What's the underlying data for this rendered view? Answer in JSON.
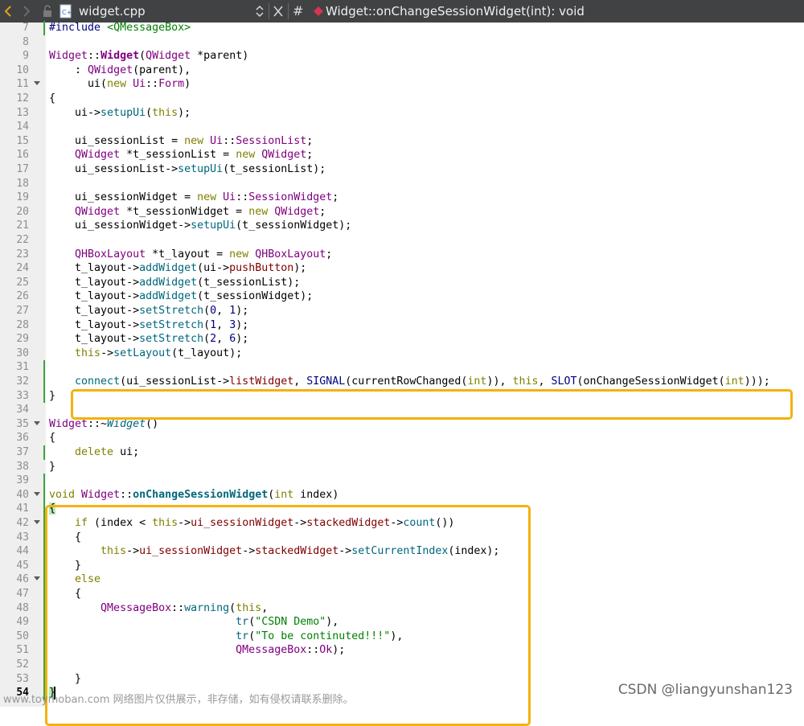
{
  "toolbar": {
    "file_name": "widget.cpp",
    "symbol": "Widget::onChangeSessionWidget(int): void",
    "hash": "#"
  },
  "watermarks": {
    "left": "www.toymoban.com 网络图片仅供展示，非存储，如有侵权请联系删除。",
    "right": "CSDN @liangyunshan123"
  },
  "colors": {
    "toolbar_bg": "#404244",
    "highlight_box": "#f5b10f",
    "change_marker": "#3da53d",
    "type": "#800080",
    "keyword": "#808000",
    "function": "#00677c",
    "string": "#008000"
  },
  "code_lines": [
    {
      "n": "7",
      "fold": false,
      "chg": true,
      "segs": [
        [
          "#include ",
          "pp"
        ],
        [
          "<QMessageBox>",
          "str"
        ]
      ]
    },
    {
      "n": "8",
      "fold": false,
      "chg": false,
      "segs": []
    },
    {
      "n": "9",
      "fold": false,
      "chg": false,
      "segs": [
        [
          "Widget",
          "type"
        ],
        [
          "::",
          ""
        ],
        [
          "Widget",
          "type bold"
        ],
        [
          "(",
          ""
        ],
        [
          "QWidget",
          "type"
        ],
        [
          " *parent)",
          ""
        ]
      ]
    },
    {
      "n": "10",
      "fold": false,
      "chg": false,
      "segs": [
        [
          "    : ",
          ""
        ],
        [
          "QWidget",
          "type"
        ],
        [
          "(parent),",
          ""
        ]
      ]
    },
    {
      "n": "11",
      "fold": true,
      "chg": false,
      "segs": [
        [
          "      ui(",
          ""
        ],
        [
          "new",
          "kw"
        ],
        [
          " ",
          ""
        ],
        [
          "Ui",
          "type"
        ],
        [
          "::",
          ""
        ],
        [
          "Form",
          "type"
        ],
        [
          ")",
          ""
        ]
      ]
    },
    {
      "n": "12",
      "fold": false,
      "chg": false,
      "segs": [
        [
          "{",
          ""
        ]
      ]
    },
    {
      "n": "13",
      "fold": false,
      "chg": false,
      "segs": [
        [
          "    ui->",
          ""
        ],
        [
          "setupUi",
          "fn"
        ],
        [
          "(",
          ""
        ],
        [
          "this",
          "kw"
        ],
        [
          ");",
          ""
        ]
      ]
    },
    {
      "n": "14",
      "fold": false,
      "chg": false,
      "segs": []
    },
    {
      "n": "15",
      "fold": false,
      "chg": false,
      "segs": [
        [
          "    ui_sessionList = ",
          ""
        ],
        [
          "new",
          "kw"
        ],
        [
          " ",
          ""
        ],
        [
          "Ui",
          "type"
        ],
        [
          "::",
          ""
        ],
        [
          "SessionList",
          "type"
        ],
        [
          ";",
          ""
        ]
      ]
    },
    {
      "n": "16",
      "fold": false,
      "chg": false,
      "segs": [
        [
          "    ",
          ""
        ],
        [
          "QWidget",
          "type"
        ],
        [
          " *t_sessionList = ",
          ""
        ],
        [
          "new",
          "kw"
        ],
        [
          " ",
          ""
        ],
        [
          "QWidget",
          "type"
        ],
        [
          ";",
          ""
        ]
      ]
    },
    {
      "n": "17",
      "fold": false,
      "chg": false,
      "segs": [
        [
          "    ui_sessionList->",
          ""
        ],
        [
          "setupUi",
          "fn"
        ],
        [
          "(t_sessionList);",
          ""
        ]
      ]
    },
    {
      "n": "18",
      "fold": false,
      "chg": false,
      "segs": []
    },
    {
      "n": "19",
      "fold": false,
      "chg": false,
      "segs": [
        [
          "    ui_sessionWidget = ",
          ""
        ],
        [
          "new",
          "kw"
        ],
        [
          " ",
          ""
        ],
        [
          "Ui",
          "type"
        ],
        [
          "::",
          ""
        ],
        [
          "SessionWidget",
          "type"
        ],
        [
          ";",
          ""
        ]
      ]
    },
    {
      "n": "20",
      "fold": false,
      "chg": false,
      "segs": [
        [
          "    ",
          ""
        ],
        [
          "QWidget",
          "type"
        ],
        [
          " *t_sessionWidget = ",
          ""
        ],
        [
          "new",
          "kw"
        ],
        [
          " ",
          ""
        ],
        [
          "QWidget",
          "type"
        ],
        [
          ";",
          ""
        ]
      ]
    },
    {
      "n": "21",
      "fold": false,
      "chg": false,
      "segs": [
        [
          "    ui_sessionWidget->",
          ""
        ],
        [
          "setupUi",
          "fn"
        ],
        [
          "(t_sessionWidget);",
          ""
        ]
      ]
    },
    {
      "n": "22",
      "fold": false,
      "chg": false,
      "segs": []
    },
    {
      "n": "23",
      "fold": false,
      "chg": false,
      "segs": [
        [
          "    ",
          ""
        ],
        [
          "QHBoxLayout",
          "type"
        ],
        [
          " *t_layout = ",
          ""
        ],
        [
          "new",
          "kw"
        ],
        [
          " ",
          ""
        ],
        [
          "QHBoxLayout",
          "type"
        ],
        [
          ";",
          ""
        ]
      ]
    },
    {
      "n": "24",
      "fold": false,
      "chg": false,
      "segs": [
        [
          "    t_layout->",
          ""
        ],
        [
          "addWidget",
          "fn"
        ],
        [
          "(ui->",
          ""
        ],
        [
          "pushButton",
          "mem"
        ],
        [
          ");",
          ""
        ]
      ]
    },
    {
      "n": "25",
      "fold": false,
      "chg": false,
      "segs": [
        [
          "    t_layout->",
          ""
        ],
        [
          "addWidget",
          "fn"
        ],
        [
          "(t_sessionList);",
          ""
        ]
      ]
    },
    {
      "n": "26",
      "fold": false,
      "chg": false,
      "segs": [
        [
          "    t_layout->",
          ""
        ],
        [
          "addWidget",
          "fn"
        ],
        [
          "(t_sessionWidget);",
          ""
        ]
      ]
    },
    {
      "n": "27",
      "fold": false,
      "chg": false,
      "segs": [
        [
          "    t_layout->",
          ""
        ],
        [
          "setStretch",
          "fn"
        ],
        [
          "(",
          ""
        ],
        [
          "0",
          "num"
        ],
        [
          ", ",
          ""
        ],
        [
          "1",
          "num"
        ],
        [
          ");",
          ""
        ]
      ]
    },
    {
      "n": "28",
      "fold": false,
      "chg": false,
      "segs": [
        [
          "    t_layout->",
          ""
        ],
        [
          "setStretch",
          "fn"
        ],
        [
          "(",
          ""
        ],
        [
          "1",
          "num"
        ],
        [
          ", ",
          ""
        ],
        [
          "3",
          "num"
        ],
        [
          ");",
          ""
        ]
      ]
    },
    {
      "n": "29",
      "fold": false,
      "chg": false,
      "segs": [
        [
          "    t_layout->",
          ""
        ],
        [
          "setStretch",
          "fn"
        ],
        [
          "(",
          ""
        ],
        [
          "2",
          "num"
        ],
        [
          ", ",
          ""
        ],
        [
          "6",
          "num"
        ],
        [
          ");",
          ""
        ]
      ]
    },
    {
      "n": "30",
      "fold": false,
      "chg": false,
      "segs": [
        [
          "    ",
          ""
        ],
        [
          "this",
          "kw"
        ],
        [
          "->",
          ""
        ],
        [
          "setLayout",
          "fn"
        ],
        [
          "(t_layout);",
          ""
        ]
      ]
    },
    {
      "n": "31",
      "fold": false,
      "chg": true,
      "segs": []
    },
    {
      "n": "32",
      "fold": false,
      "chg": true,
      "segs": [
        [
          "    ",
          ""
        ],
        [
          "connect",
          "fn"
        ],
        [
          "(ui_sessionList->",
          ""
        ],
        [
          "listWidget",
          "mem"
        ],
        [
          ", ",
          ""
        ],
        [
          "SIGNAL",
          "mac"
        ],
        [
          "(currentRowChanged(",
          ""
        ],
        [
          "int",
          "kw"
        ],
        [
          ")), ",
          ""
        ],
        [
          "this",
          "kw"
        ],
        [
          ", ",
          ""
        ],
        [
          "SLOT",
          "mac"
        ],
        [
          "(onChangeSessionWidget(",
          ""
        ],
        [
          "int",
          "kw"
        ],
        [
          ")));",
          ""
        ]
      ]
    },
    {
      "n": "33",
      "fold": false,
      "chg": true,
      "segs": [
        [
          "}",
          ""
        ]
      ]
    },
    {
      "n": "34",
      "fold": false,
      "chg": false,
      "segs": []
    },
    {
      "n": "35",
      "fold": true,
      "chg": false,
      "segs": [
        [
          "Widget",
          "type"
        ],
        [
          "::~",
          ""
        ],
        [
          "Widget",
          "fn ital"
        ],
        [
          "()",
          ""
        ]
      ]
    },
    {
      "n": "36",
      "fold": false,
      "chg": false,
      "segs": [
        [
          "{",
          ""
        ]
      ]
    },
    {
      "n": "37",
      "fold": false,
      "chg": true,
      "segs": [
        [
          "    ",
          ""
        ],
        [
          "delete",
          "kw"
        ],
        [
          " ui;",
          ""
        ]
      ]
    },
    {
      "n": "38",
      "fold": false,
      "chg": false,
      "segs": [
        [
          "}",
          ""
        ]
      ]
    },
    {
      "n": "39",
      "fold": false,
      "chg": true,
      "segs": []
    },
    {
      "n": "40",
      "fold": true,
      "chg": true,
      "segs": [
        [
          "void",
          "kw"
        ],
        [
          " ",
          ""
        ],
        [
          "Widget",
          "type"
        ],
        [
          "::",
          ""
        ],
        [
          "onChangeSessionWidget",
          "fn bold"
        ],
        [
          "(",
          ""
        ],
        [
          "int",
          "kw"
        ],
        [
          " index)",
          ""
        ]
      ]
    },
    {
      "n": "41",
      "fold": false,
      "chg": true,
      "segs": [
        [
          "{",
          "brace"
        ]
      ]
    },
    {
      "n": "42",
      "fold": true,
      "chg": true,
      "segs": [
        [
          "    ",
          ""
        ],
        [
          "if",
          "kw"
        ],
        [
          " (index < ",
          ""
        ],
        [
          "this",
          "kw"
        ],
        [
          "->",
          ""
        ],
        [
          "ui_sessionWidget",
          "mem"
        ],
        [
          "->",
          ""
        ],
        [
          "stackedWidget",
          "mem"
        ],
        [
          "->",
          ""
        ],
        [
          "count",
          "fn"
        ],
        [
          "())",
          ""
        ]
      ]
    },
    {
      "n": "43",
      "fold": false,
      "chg": true,
      "segs": [
        [
          "    {",
          ""
        ]
      ]
    },
    {
      "n": "44",
      "fold": false,
      "chg": true,
      "segs": [
        [
          "        ",
          ""
        ],
        [
          "this",
          "kw"
        ],
        [
          "->",
          ""
        ],
        [
          "ui_sessionWidget",
          "mem"
        ],
        [
          "->",
          ""
        ],
        [
          "stackedWidget",
          "mem"
        ],
        [
          "->",
          ""
        ],
        [
          "setCurrentIndex",
          "fn"
        ],
        [
          "(index);",
          ""
        ]
      ]
    },
    {
      "n": "45",
      "fold": false,
      "chg": true,
      "segs": [
        [
          "    }",
          ""
        ]
      ]
    },
    {
      "n": "46",
      "fold": true,
      "chg": true,
      "segs": [
        [
          "    ",
          ""
        ],
        [
          "else",
          "kw"
        ]
      ]
    },
    {
      "n": "47",
      "fold": false,
      "chg": true,
      "segs": [
        [
          "    {",
          ""
        ]
      ]
    },
    {
      "n": "48",
      "fold": false,
      "chg": true,
      "segs": [
        [
          "        ",
          ""
        ],
        [
          "QMessageBox",
          "type"
        ],
        [
          "::",
          ""
        ],
        [
          "warning",
          "fn"
        ],
        [
          "(",
          ""
        ],
        [
          "this",
          "kw"
        ],
        [
          ",",
          ""
        ]
      ]
    },
    {
      "n": "49",
      "fold": false,
      "chg": true,
      "segs": [
        [
          "                             ",
          ""
        ],
        [
          "tr",
          "fn"
        ],
        [
          "(",
          ""
        ],
        [
          "\"CSDN Demo\"",
          "str"
        ],
        [
          "),",
          ""
        ]
      ]
    },
    {
      "n": "50",
      "fold": false,
      "chg": true,
      "segs": [
        [
          "                             ",
          ""
        ],
        [
          "tr",
          "fn"
        ],
        [
          "(",
          ""
        ],
        [
          "\"To be continuted!!!\"",
          "str"
        ],
        [
          "),",
          ""
        ]
      ]
    },
    {
      "n": "51",
      "fold": false,
      "chg": true,
      "segs": [
        [
          "                             ",
          ""
        ],
        [
          "QMessageBox",
          "type"
        ],
        [
          "::",
          ""
        ],
        [
          "Ok",
          "type"
        ],
        [
          ");",
          ""
        ]
      ]
    },
    {
      "n": "52",
      "fold": false,
      "chg": true,
      "segs": []
    },
    {
      "n": "53",
      "fold": false,
      "chg": true,
      "segs": [
        [
          "    }",
          ""
        ]
      ]
    },
    {
      "n": "54",
      "fold": false,
      "chg": true,
      "cur": true,
      "segs": [
        [
          "}",
          "brace"
        ]
      ]
    }
  ]
}
